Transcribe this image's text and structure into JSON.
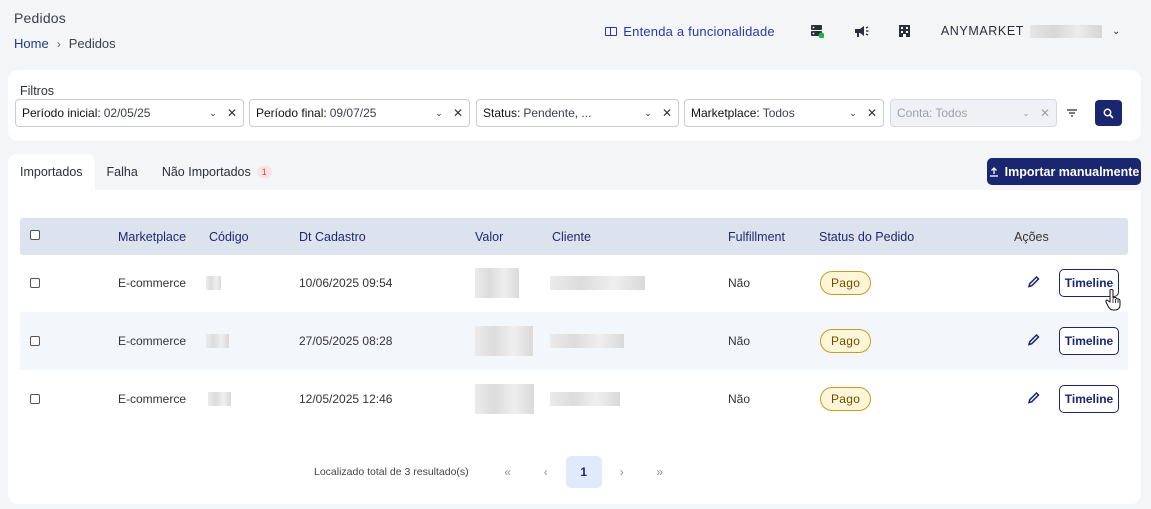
{
  "header": {
    "title": "Pedidos",
    "breadcrumb": {
      "home": "Home",
      "current": "Pedidos"
    },
    "help_link": "Entenda a funcionalidade",
    "account": "ANYMARKET"
  },
  "filters": {
    "title": "Filtros",
    "items": [
      {
        "label": "Período inicial:",
        "value": "02/05/25"
      },
      {
        "label": "Período final:",
        "value": "09/07/25"
      },
      {
        "label": "Status:",
        "value": "Pendente, ..."
      },
      {
        "label": "Marketplace:",
        "value": "Todos"
      },
      {
        "label": "Conta:",
        "value": "Todos"
      }
    ]
  },
  "tabs": [
    {
      "label": "Importados"
    },
    {
      "label": "Falha"
    },
    {
      "label": "Não Importados",
      "badge": "1"
    }
  ],
  "import_button": "Importar manualmente",
  "table": {
    "headers": [
      "Marketplace",
      "Código",
      "Dt Cadastro",
      "Valor",
      "Cliente",
      "Fulfillment",
      "Status do Pedido",
      "Ações"
    ],
    "rows": [
      {
        "marketplace": "E-commerce",
        "dt_cadastro": "10/06/2025 09:54",
        "fulfillment": "Não",
        "status": "Pago",
        "action": "Timeline"
      },
      {
        "marketplace": "E-commerce",
        "dt_cadastro": "27/05/2025 08:28",
        "fulfillment": "Não",
        "status": "Pago",
        "action": "Timeline"
      },
      {
        "marketplace": "E-commerce",
        "dt_cadastro": "12/05/2025 12:46",
        "fulfillment": "Não",
        "status": "Pago",
        "action": "Timeline"
      }
    ]
  },
  "pagination": {
    "summary": "Localizado total de 3 resultado(s)",
    "current_page": "1"
  },
  "colors": {
    "primary": "#1a2670",
    "link": "#2838b0",
    "header_row": "#dde3ee",
    "status_pago_bg": "#fff6d8",
    "status_pago_border": "#c89a25"
  }
}
